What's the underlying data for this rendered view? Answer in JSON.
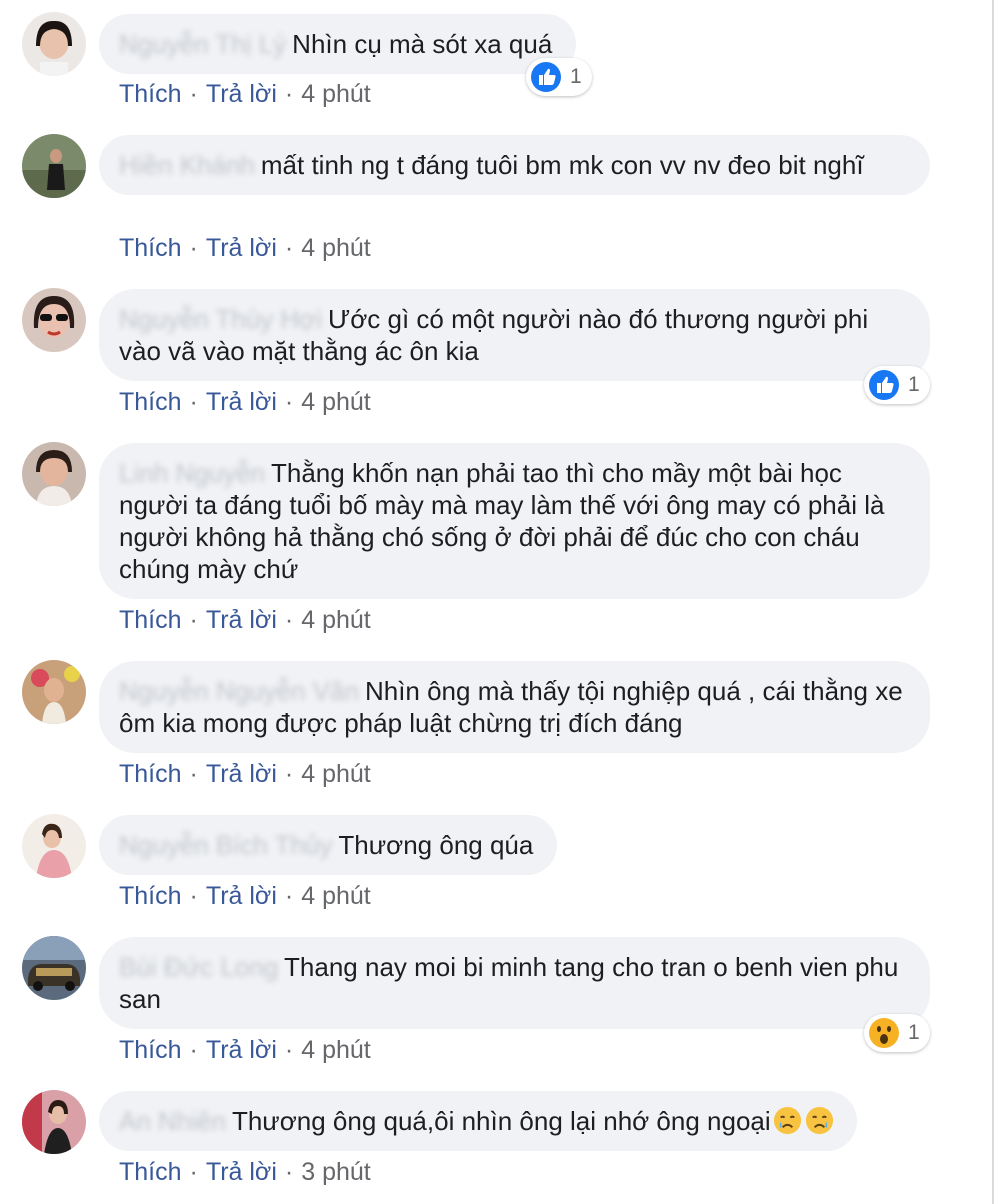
{
  "labels": {
    "like": "Thích",
    "reply": "Trả lời",
    "dot": "·"
  },
  "comments": [
    {
      "name": "Nguyễn Thị Lý",
      "text": "Nhìn cụ mà sót xa quá",
      "time": "4 phút",
      "reaction": {
        "type": "like",
        "count": "1"
      }
    },
    {
      "name": "Hiền Khánh",
      "text": "mất tinh ng t đáng tuôi bm mk con vv nv đeo bit nghĩ",
      "time": "4 phút"
    },
    {
      "name": "Nguyễn Thùy Hợi",
      "text": "Ước gì có một người nào đó thương người phi vào vã vào mặt thằng ác ôn kia",
      "time": "4 phút",
      "reaction": {
        "type": "like",
        "count": "1"
      }
    },
    {
      "name": "Linh Nguyễn",
      "text": "Thằng khốn nạn phải tao thì cho mầy một bài học người ta đáng tuổi bố mày mà may làm thế với ông may có phải là người không hả thằng chó sống ở đời phải để đúc cho con cháu chúng mày chứ",
      "time": "4 phút"
    },
    {
      "name": "Nguyễn Nguyễn Văn",
      "text": "Nhìn ông mà thấy tội nghiệp quá , cái thằng xe ôm kia mong được pháp luật chừng trị đích đáng",
      "time": "4 phút"
    },
    {
      "name": "Nguyễn Bích Thủy",
      "text": "Thương ông qúa",
      "time": "4 phút"
    },
    {
      "name": "Bùi Đức Long",
      "text": "Thang nay moi bi minh tang cho tran o benh vien phu san",
      "time": "4 phút",
      "reaction": {
        "type": "wow",
        "count": "1"
      }
    },
    {
      "name": "An Nhiên",
      "text": "Thương ông quá,ôi nhìn ông lại nhớ ông ngoại",
      "time": "3 phút",
      "emoji": [
        "crying-face",
        "crying-face"
      ]
    }
  ],
  "colors": {
    "bubble": "#f0f2f5",
    "link": "#385898",
    "like_blue": "#1877f2",
    "wow_yellow": "#f7b125"
  }
}
